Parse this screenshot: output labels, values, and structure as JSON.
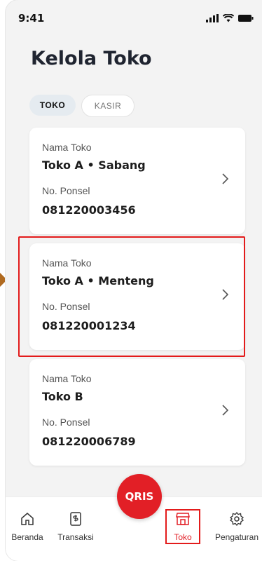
{
  "status": {
    "time": "9:41"
  },
  "header": {
    "title": "Kelola Toko"
  },
  "tabs": [
    {
      "label": "TOKO",
      "active": true
    },
    {
      "label": "KASIR",
      "active": false
    }
  ],
  "stores": [
    {
      "name_label": "Nama Toko",
      "name": "Toko A • Sabang",
      "phone_label": "No. Ponsel",
      "phone": "081220003456"
    },
    {
      "name_label": "Nama Toko",
      "name": "Toko A • Menteng",
      "phone_label": "No. Ponsel",
      "phone": "081220001234"
    },
    {
      "name_label": "Nama Toko",
      "name": "Toko B",
      "phone_label": "No. Ponsel",
      "phone": "081220006789"
    }
  ],
  "fab": {
    "label": "QRIS"
  },
  "bottom_nav": [
    {
      "label": "Beranda",
      "icon": "home-icon"
    },
    {
      "label": "Transaksi",
      "icon": "receipt-icon"
    },
    {
      "label": "Toko",
      "icon": "store-icon",
      "active": true
    },
    {
      "label": "Pengaturan",
      "icon": "gear-icon"
    }
  ],
  "colors": {
    "accent": "#e21f26",
    "highlight": "#e31b1b",
    "background": "#f3f3f3"
  }
}
